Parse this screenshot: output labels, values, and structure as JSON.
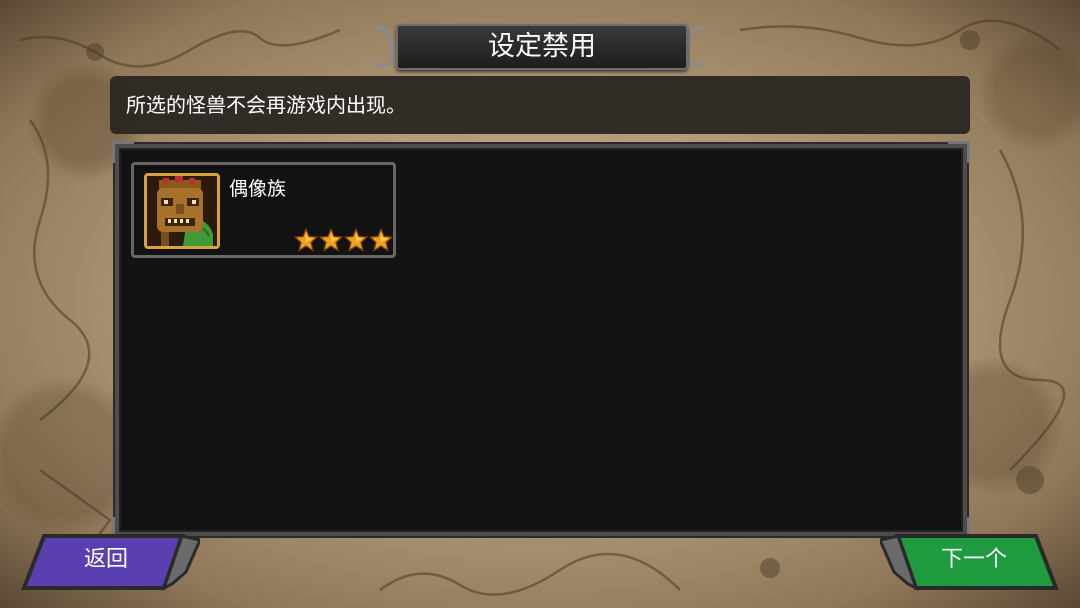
{
  "header": {
    "title": "设定禁用"
  },
  "info": {
    "message": "所选的怪兽不会再游戏内出现。"
  },
  "monsters": [
    {
      "name": "偶像族",
      "stars": 4,
      "icon": "tiki-mask-monster-icon"
    }
  ],
  "footer": {
    "back_label": "返回",
    "next_label": "下一个"
  },
  "colors": {
    "back_button": "#5a3fb0",
    "next_button": "#1f9a3f",
    "star": "#f0a020",
    "portrait_border": "#d7a33a"
  }
}
